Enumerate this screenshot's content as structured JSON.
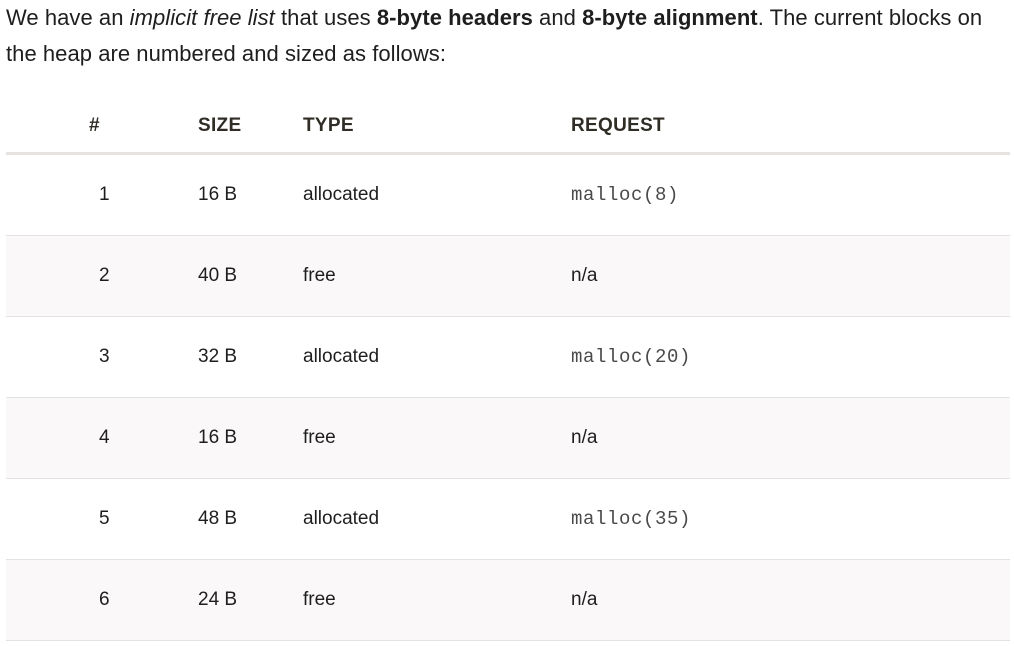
{
  "intro": {
    "part1": "We have an ",
    "italic": "implicit free list",
    "part2": " that uses ",
    "bold1": "8-byte headers",
    "part3": " and ",
    "bold2": "8-byte alignment",
    "part4": ". The current blocks on the heap are numbered and sized as follows:"
  },
  "table": {
    "headers": {
      "num": "#",
      "size": "SIZE",
      "type": "TYPE",
      "request": "REQUEST"
    },
    "rows": [
      {
        "num": "1",
        "size": "16 B",
        "type": "allocated",
        "request": "malloc(8)",
        "request_is_code": true
      },
      {
        "num": "2",
        "size": "40 B",
        "type": "free",
        "request": "n/a",
        "request_is_code": false
      },
      {
        "num": "3",
        "size": "32 B",
        "type": "allocated",
        "request": "malloc(20)",
        "request_is_code": true
      },
      {
        "num": "4",
        "size": "16 B",
        "type": "free",
        "request": "n/a",
        "request_is_code": false
      },
      {
        "num": "5",
        "size": "48 B",
        "type": "allocated",
        "request": "malloc(35)",
        "request_is_code": true
      },
      {
        "num": "6",
        "size": "24 B",
        "type": "free",
        "request": "n/a",
        "request_is_code": false
      }
    ]
  }
}
